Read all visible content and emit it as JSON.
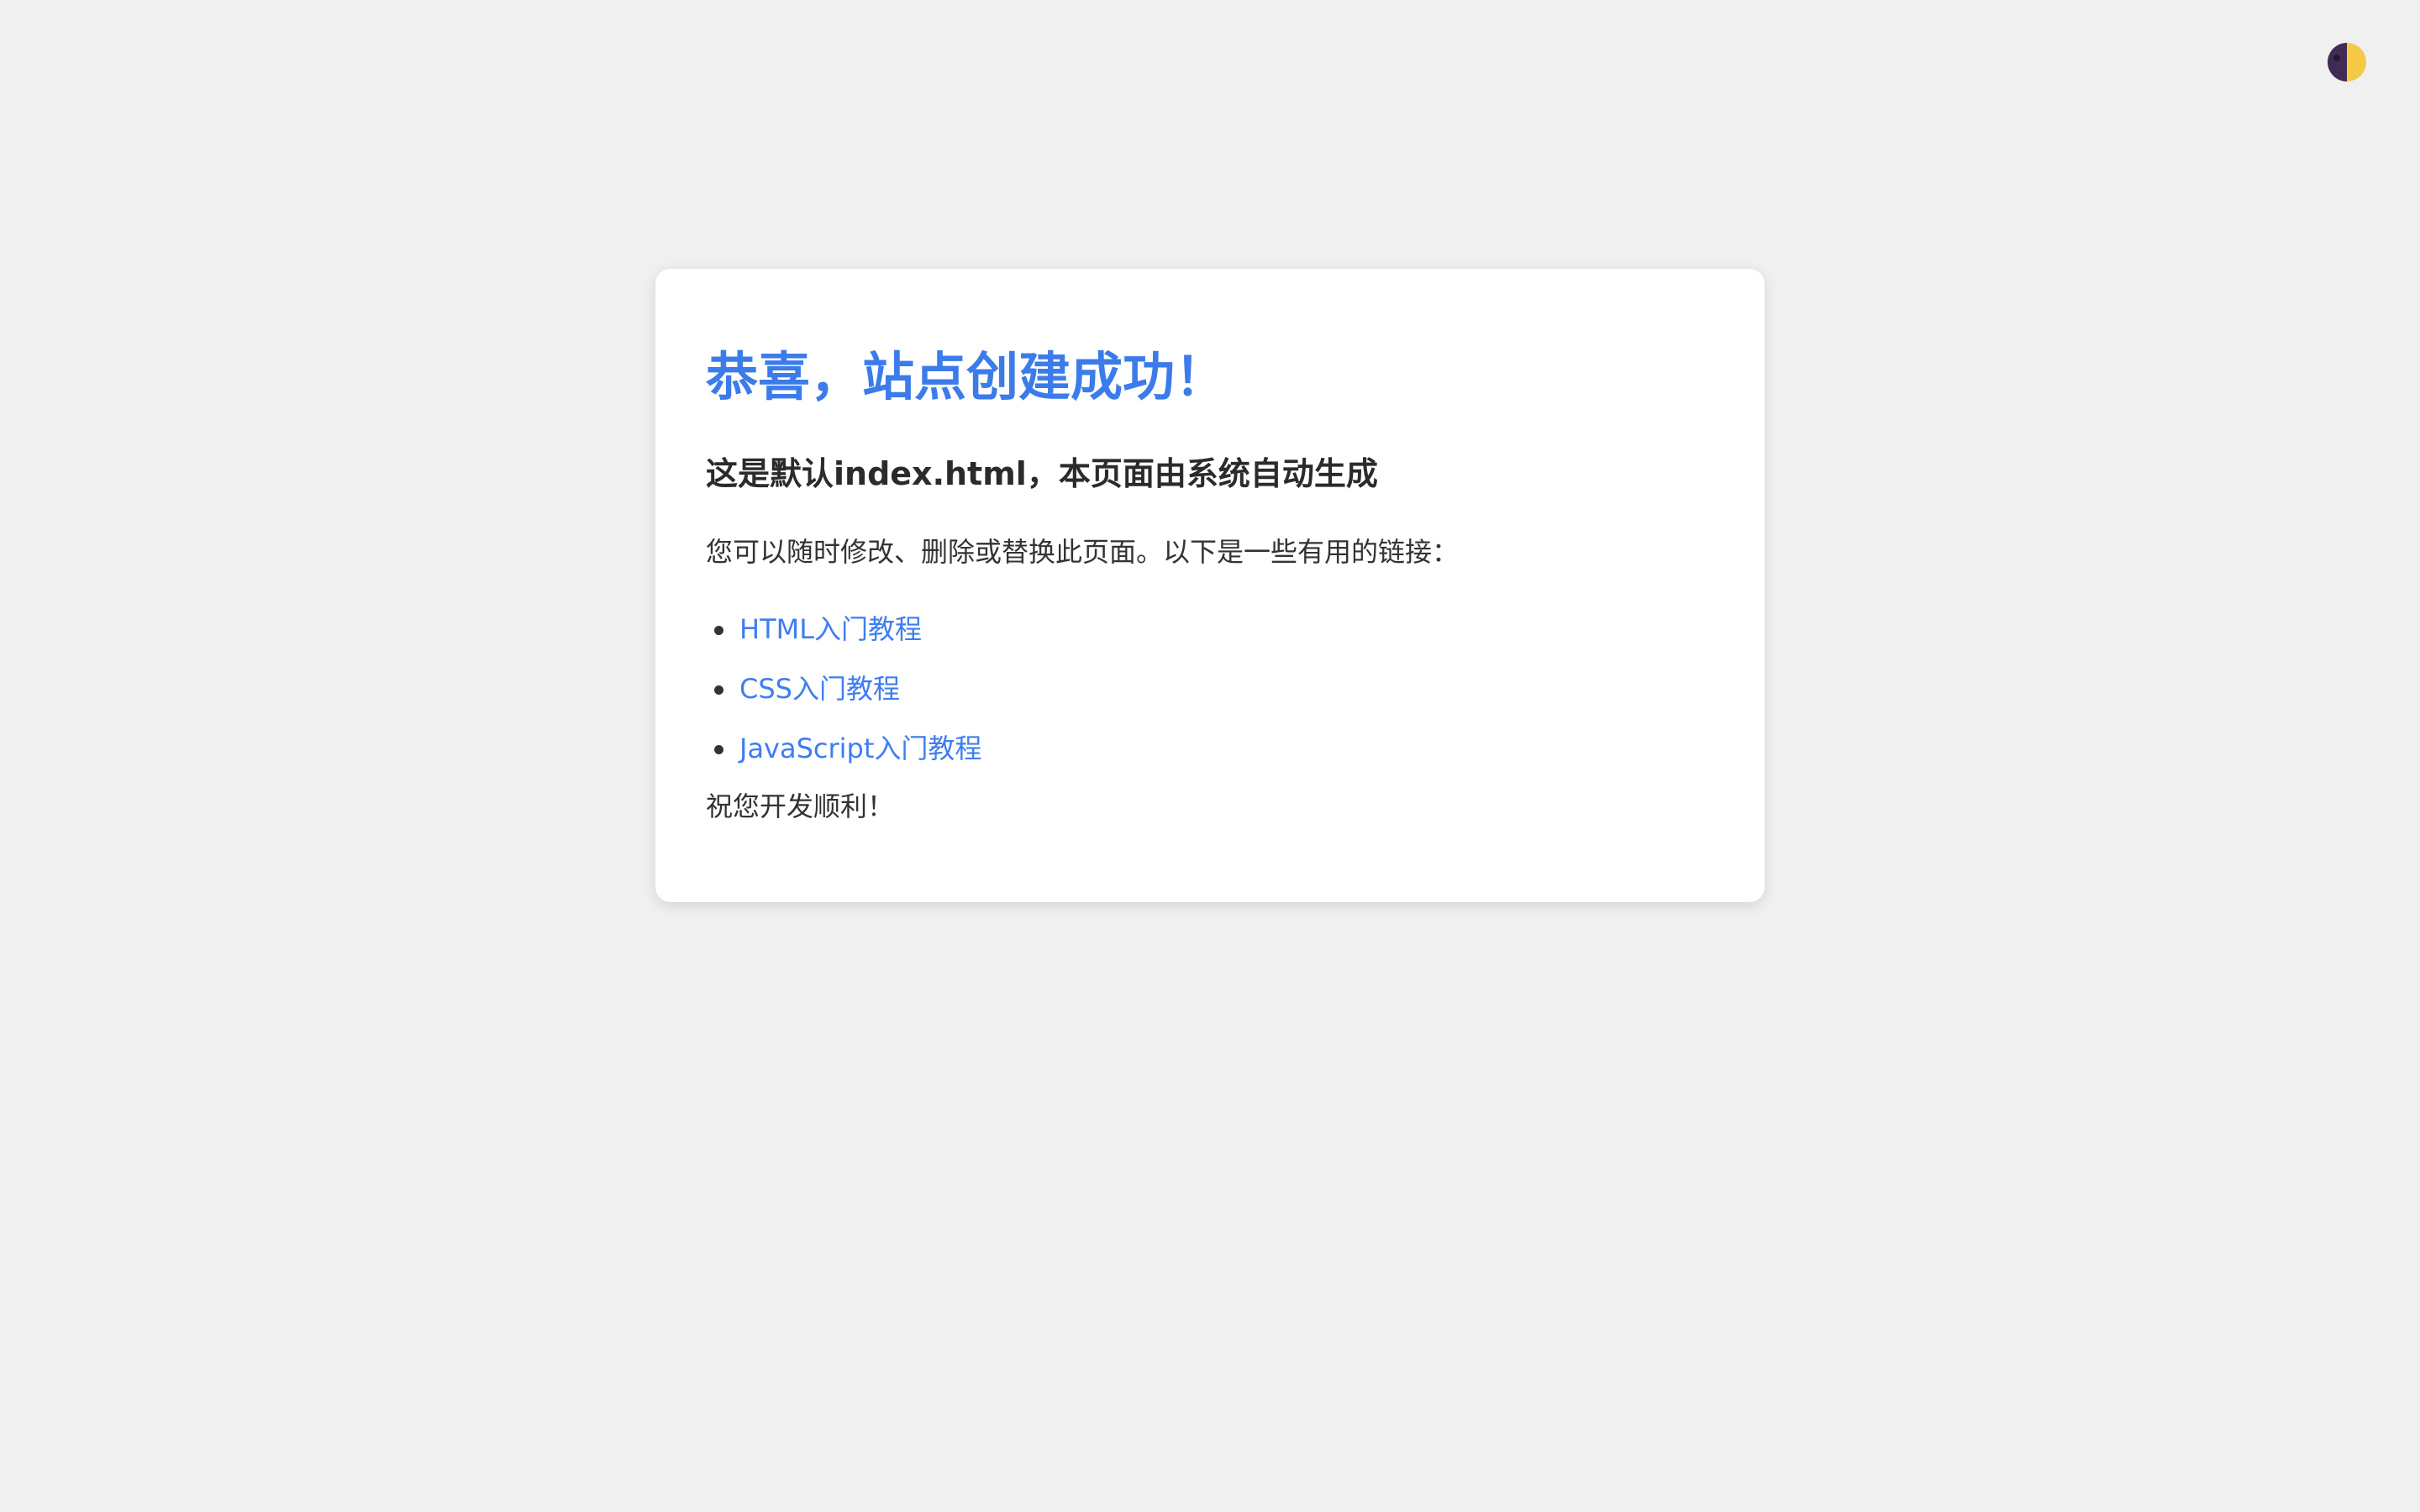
{
  "page": {
    "title": "恭喜，站点创建成功！",
    "subtitle": "这是默认index.html，本页面由系统自动生成",
    "intro": "您可以随时修改、删除或替换此页面。以下是一些有用的链接：",
    "links": [
      {
        "label": "HTML入门教程"
      },
      {
        "label": "CSS入门教程"
      },
      {
        "label": "JavaScript入门教程"
      }
    ],
    "closing": "祝您开发顺利！"
  },
  "theme_toggle": {
    "icon": "half-moon-sun-icon",
    "colors": {
      "dark": "#3f2b55",
      "light": "#f5c948"
    }
  },
  "colors": {
    "background": "#f0f0f0",
    "card": "#ffffff",
    "accent": "#3c7bea",
    "link": "#3f7df0",
    "text": "#333333"
  }
}
